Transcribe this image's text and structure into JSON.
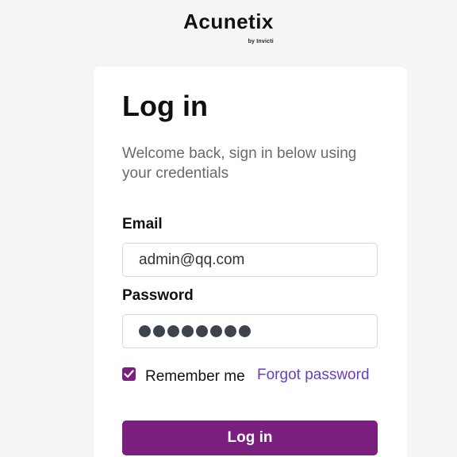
{
  "logo": {
    "name": "Acunetix",
    "tagline": "by Invicti"
  },
  "login": {
    "title": "Log in",
    "subtitle": "Welcome back, sign in below using your credentials",
    "email_label": "Email",
    "email_value": "admin@qq.com",
    "password_label": "Password",
    "password_mask_length": 8,
    "remember_checked": true,
    "remember_label": "Remember me",
    "forgot_link": "Forgot password",
    "submit_label": "Log in"
  },
  "colors": {
    "brand_purple": "#7b1f7f",
    "link_purple": "#6a3cc8",
    "page_background": "#f5f5f5"
  }
}
